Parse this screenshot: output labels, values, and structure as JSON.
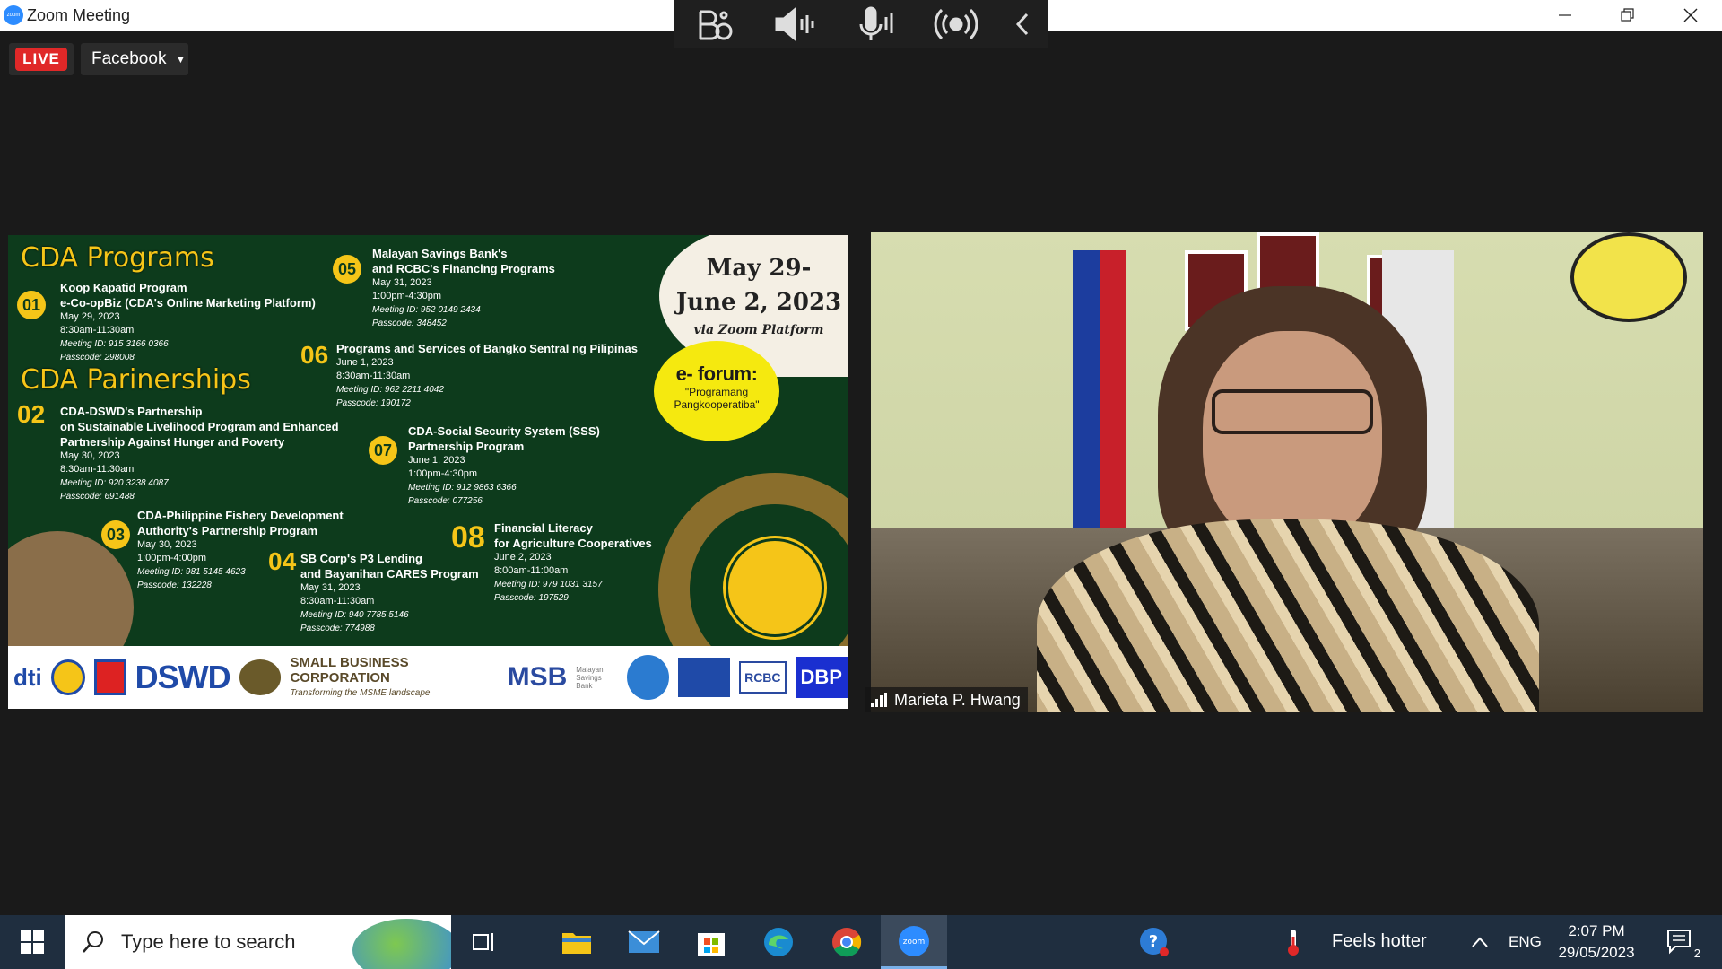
{
  "window": {
    "title": "Zoom Meeting",
    "logo_text": "zoom"
  },
  "live": {
    "badge": "LIVE",
    "platform": "Facebook"
  },
  "poster": {
    "date_line1": "May 29-",
    "date_line2": "June 2, 2023",
    "via": "via Zoom Platform",
    "eforum_title": "e- forum:",
    "eforum_sub": "\"Programang Pangkooperatiba\"",
    "section1": "CDA Programs",
    "section2": "CDA Parinerships",
    "programs": [
      {
        "num": "01",
        "name": "Koop Kapatid Program\ne-Co-opBiz (CDA's Online Marketing Platform)",
        "date": "May 29, 2023",
        "time": "8:30am-11:30am",
        "meeting": "Meeting ID: 915 3166 0366",
        "pass": "Passcode: 298008"
      },
      {
        "num": "02",
        "name": "CDA-DSWD's Partnership\non Sustainable Livelihood Program and Enhanced\nPartnership Against Hunger and Poverty",
        "date": "May 30, 2023",
        "time": "8:30am-11:30am",
        "meeting": "Meeting ID: 920 3238 4087",
        "pass": "Passcode: 691488"
      },
      {
        "num": "03",
        "name": "CDA-Philippine Fishery Development\nAuthority's Partnership Program",
        "date": "May 30, 2023",
        "time": "1:00pm-4:00pm",
        "meeting": "Meeting ID: 981 5145 4623",
        "pass": "Passcode: 132228"
      },
      {
        "num": "04",
        "name": "SB Corp's P3 Lending\nand Bayanihan CARES Program",
        "date": "May 31, 2023",
        "time": "8:30am-11:30am",
        "meeting": "Meeting ID: 940 7785 5146",
        "pass": "Passcode: 774988"
      },
      {
        "num": "05",
        "name": "Malayan Savings Bank's\nand RCBC's Financing Programs",
        "date": "May 31, 2023",
        "time": "1:00pm-4:30pm",
        "meeting": "Meeting ID: 952 0149 2434",
        "pass": "Passcode: 348452"
      },
      {
        "num": "06",
        "name": "Programs and Services of Bangko Sentral ng Pilipinas",
        "date": "June 1, 2023",
        "time": "8:30am-11:30am",
        "meeting": "Meeting ID: 962 2211 4042",
        "pass": "Passcode: 190172"
      },
      {
        "num": "07",
        "name": "CDA-Social Security System (SSS)\nPartnership Program",
        "date": "June 1, 2023",
        "time": "1:00pm-4:30pm",
        "meeting": "Meeting ID: 912 9863 6366",
        "pass": "Passcode: 077256"
      },
      {
        "num": "08",
        "name": "Financial Literacy\nfor Agriculture Cooperatives",
        "date": "June 2, 2023",
        "time": "8:00am-11:00am",
        "meeting": "Meeting ID: 979 1031 3157",
        "pass": "Passcode: 197529"
      }
    ],
    "logos": [
      "dti",
      "DSWD",
      "SMALL BUSINESS CORPORATION",
      "Transforming the MSME landscape",
      "MSB",
      "Malayan Savings Bank",
      "RCBC",
      "DBP"
    ]
  },
  "participant": {
    "name": "Marieta P. Hwang"
  },
  "taskbar": {
    "search_placeholder": "Type here to search",
    "weather": "Feels hotter",
    "language": "ENG",
    "time": "2:07 PM",
    "date": "29/05/2023",
    "notifications": "2"
  },
  "colors": {
    "live": "#e02828",
    "poster_bg": "#0d3b1c",
    "accent_yellow": "#f5c518",
    "taskbar": "#1f2e3f"
  }
}
